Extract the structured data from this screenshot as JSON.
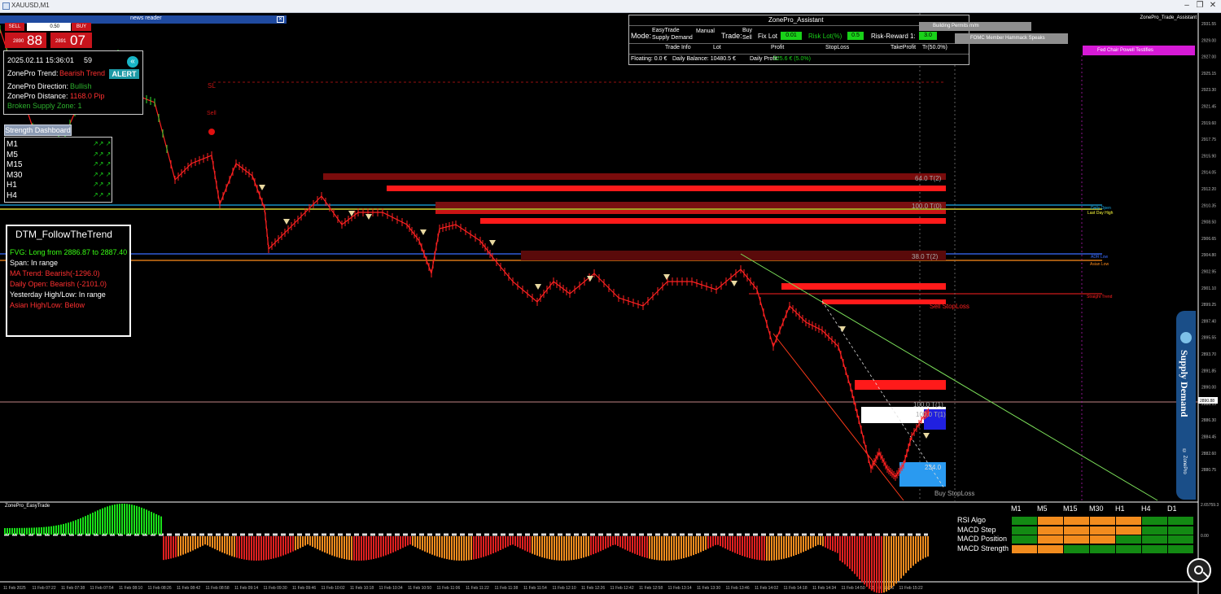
{
  "window": {
    "title": "XAUUSD,M1",
    "indicator_name": "ZonePro_Trade_Assistant"
  },
  "news_reader": {
    "title": "news reader",
    "items": [
      "Building Permits m/m",
      "FOMC Member Hammack Speaks",
      "Fed Chair Powell Testifies"
    ]
  },
  "trade_panel": {
    "sell_label": "SELL",
    "buy_label": "BUY",
    "lot": "0.50",
    "sell_price_small": "2890",
    "sell_price_big": "88",
    "buy_price_small": "2891",
    "buy_price_big": "07"
  },
  "info_panel": {
    "datetime": "2025.02.11 15:36:01",
    "seconds": "59",
    "trend_label": "ZonePro Trend:",
    "trend_value": "Bearish Trend",
    "direction_label": "ZonePro Direction:",
    "direction_value": "Bullish",
    "distance_label": "ZonePro Distance:",
    "distance_value": "1168.0 Pip",
    "broken_zone": "Broken Supply Zone: 1",
    "alert_label": "ALERT"
  },
  "strength_dashboard": {
    "title": "Strength Dashboard",
    "timeframes": [
      "M1",
      "M5",
      "M15",
      "M30",
      "H1",
      "H4"
    ]
  },
  "dtm_panel": {
    "title": "DTM_FollowTheTrend",
    "lines": [
      {
        "text": "FVG: Long from 2886.87 to 2887.40",
        "color": "#39ff14"
      },
      {
        "text": "Span: In range",
        "color": "#ffffff"
      },
      {
        "text": "MA Trend: Bearish(-1296.0)",
        "color": "#ff3030"
      },
      {
        "text": "Daily Open: Bearish (-2101.0)",
        "color": "#ff3030"
      },
      {
        "text": "Yesterday High/Low: In range",
        "color": "#ffffff"
      },
      {
        "text": "Asian High/Low: Below",
        "color": "#ff3030"
      }
    ]
  },
  "assistant": {
    "title": "ZonePro_Assistant",
    "mode_label": "Mode:",
    "mode_value_1": "EasyTrade",
    "mode_value_2": "Supply Demand",
    "manual": "Manual",
    "trade_label": "Trade:",
    "trade_buy": "Buy",
    "trade_sell": "Sell",
    "fix_lot_label": "Fix Lot",
    "fix_lot_value": "0.01",
    "risk_lot_label": "Risk Lot(%)",
    "risk_lot_value": "0.5",
    "rr_label": "Risk-Reward 1:",
    "rr_value": "3.0",
    "cols": [
      "Trade Info",
      "Lot",
      "Profit",
      "StopLoss",
      "TakeProfit",
      "Tr(50.0%)"
    ],
    "floating": "Floating: 0.0 €",
    "daily_balance": "Daily Balance: 10480.5 €",
    "daily_profit_label": "Daily Profit:",
    "daily_profit_value": "525.6 € (5.0%)"
  },
  "chart_labels": {
    "sl": "SL",
    "sell": "Sell",
    "t2_top": "64.0 T(2)",
    "t0_mid": "100.0 T(0)",
    "t2_mid": "38.0 T(2)",
    "sell_stoploss": "Sell StopLoss",
    "t1_a": "100.0 T(1)",
    "t1_b": "100.0 T(1)",
    "zone_val": "234.0",
    "buy_stoploss": "Buy StopLoss",
    "daily_open": "Daily Open",
    "last_day_high": "Last Day High",
    "adr_low": "ADR Low",
    "asian_low": "Asian Low",
    "straight_trend": "Straight Trend",
    "supply_demand_brand": "Supply Demand",
    "zonepro_brand": "© ZonePro"
  },
  "price_axis": [
    "2931.55",
    "2929.00",
    "2927.00",
    "2925.15",
    "2923.30",
    "2921.45",
    "2919.60",
    "2917.75",
    "2915.90",
    "2914.05",
    "2912.20",
    "2910.35",
    "2908.50",
    "2906.65",
    "2904.80",
    "2902.95",
    "2901.10",
    "2899.25",
    "2897.40",
    "2895.55",
    "2893.70",
    "2891.85",
    "2890.00",
    "2888.15",
    "2886.30",
    "2884.45",
    "2882.60",
    "2880.75"
  ],
  "current_price": "2890.88",
  "time_axis": [
    "11 Feb 2025",
    "11 Feb 07:22",
    "11 Feb 07:38",
    "11 Feb 07:54",
    "11 Feb 08:10",
    "11 Feb 08:26",
    "11 Feb 08:42",
    "11 Feb 08:58",
    "11 Feb 09:14",
    "11 Feb 09:30",
    "11 Feb 09:46",
    "11 Feb 10:02",
    "11 Feb 10:18",
    "11 Feb 10:34",
    "11 Feb 10:50",
    "11 Feb 11:06",
    "11 Feb 11:22",
    "11 Feb 11:38",
    "11 Feb 11:54",
    "11 Feb 12:10",
    "11 Feb 12:26",
    "11 Feb 12:42",
    "11 Feb 12:58",
    "11 Feb 13:14",
    "11 Feb 13:30",
    "11 Feb 13:46",
    "11 Feb 14:02",
    "11 Feb 14:18",
    "11 Feb 14:34",
    "11 Feb 14:50",
    "11 Feb 15:06",
    "11 Feb 15:22"
  ],
  "sub_window": {
    "title": "ZonePro_EasyTrade",
    "zero_label": "0.00",
    "scale_label": "2.65759.3"
  },
  "matrix": {
    "timeframes": [
      "M1",
      "M5",
      "M15",
      "M30",
      "H1",
      "H4",
      "D1"
    ],
    "rows": [
      {
        "label": "RSI Algo",
        "colors": [
          "g",
          "o",
          "o",
          "o",
          "o",
          "g",
          "g"
        ]
      },
      {
        "label": "MACD Step",
        "colors": [
          "g",
          "o",
          "o",
          "o",
          "o",
          "g",
          "g"
        ]
      },
      {
        "label": "MACD Position",
        "colors": [
          "g",
          "o",
          "o",
          "o",
          "g",
          "g",
          "g"
        ]
      },
      {
        "label": "MACD Strength",
        "colors": [
          "o",
          "o",
          "g",
          "g",
          "g",
          "g",
          "g"
        ]
      }
    ],
    "green": "#138a13",
    "orange": "#f28c1e"
  }
}
